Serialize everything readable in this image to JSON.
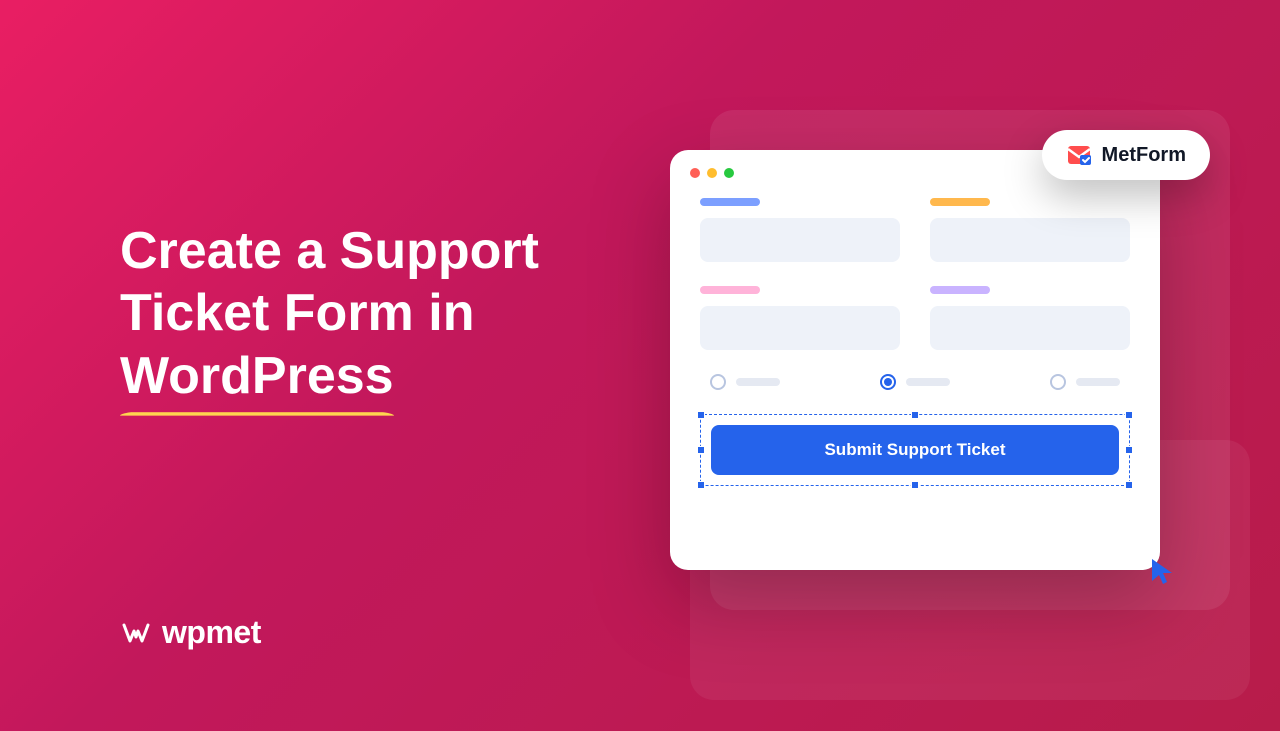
{
  "headline": {
    "line1": "Create a Support",
    "line2": "Ticket Form in",
    "highlight": "WordPress"
  },
  "brand": {
    "name": "wpmet"
  },
  "product_badge": {
    "name": "MetForm"
  },
  "form": {
    "submit_label": "Submit Support Ticket"
  }
}
